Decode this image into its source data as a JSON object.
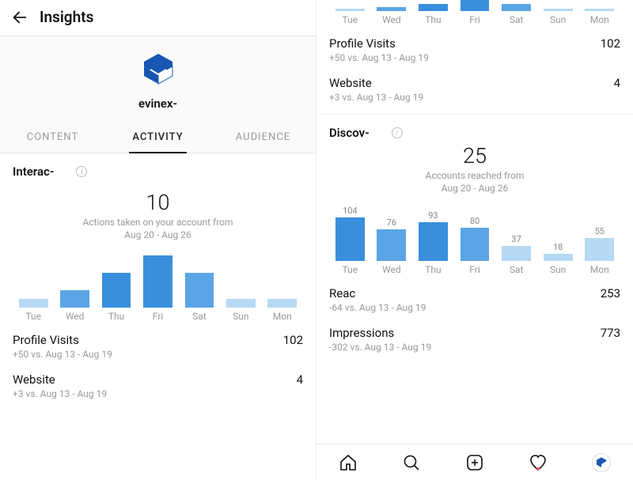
{
  "header": {
    "title": "Insights"
  },
  "profile": {
    "username": "evinex-"
  },
  "tabs": {
    "content": "CONTENT",
    "activity": "ACTIVITY",
    "audience": "AUDIENCE"
  },
  "left": {
    "section_title": "Interac-",
    "big_num": "10",
    "big_sub_l1": "Actions taken on your account from",
    "big_sub_l2": "Aug 20 - Aug 26",
    "metrics": {
      "pv_name": "Profile Visits",
      "pv_val": "102",
      "pv_sub": "+50 vs. Aug 13 - Aug 19",
      "web_name": "Website",
      "web_val": "4",
      "web_sub": "+3 vs. Aug 13 - Aug 19"
    }
  },
  "right": {
    "metrics_top": {
      "pv_name": "Profile Visits",
      "pv_val": "102",
      "pv_sub": "+50 vs. Aug 13 - Aug 19",
      "web_name": "Website",
      "web_val": "4",
      "web_sub": "+3 vs. Aug 13 - Aug 19"
    },
    "section_title": "Discov-",
    "big_num": "25",
    "big_sub_l1": "Accounts reached from",
    "big_sub_l2": "Aug 20 - Aug 26",
    "metrics_bot": {
      "reach_name": "Reac",
      "reach_val": "253",
      "reach_sub": "-64 vs. Aug 13 - Aug 19",
      "imp_name": "Impressions",
      "imp_val": "773",
      "imp_sub": "-302 vs. Aug 13 - Aug 19"
    }
  },
  "days": [
    "Tue",
    "Wed",
    "Thu",
    "Fri",
    "Sat",
    "Sun",
    "Mon"
  ],
  "chart_data": [
    {
      "type": "bar",
      "location": "left-panel interactions",
      "title": "Actions taken on your account from Aug 20 - Aug 26",
      "categories": [
        "Tue",
        "Wed",
        "Thu",
        "Fri",
        "Sat",
        "Sun",
        "Mon"
      ],
      "values": [
        0.5,
        1,
        2,
        3,
        2,
        0.5,
        0.5
      ],
      "colors": [
        "light",
        "medium",
        "dark",
        "dark",
        "medium",
        "light",
        "light"
      ],
      "total": 10,
      "note": "per-day values estimated from relative bar heights; only total (10) is labeled"
    },
    {
      "type": "bar",
      "location": "right-panel top (cropped duplicate of left chart)",
      "categories": [
        "Tue",
        "Wed",
        "Thu",
        "Fri",
        "Sat",
        "Sun",
        "Mon"
      ],
      "values": [
        0.5,
        1,
        2,
        3,
        2,
        0.5,
        0.5
      ],
      "colors": [
        "light",
        "medium",
        "dark",
        "dark",
        "medium",
        "light",
        "light"
      ]
    },
    {
      "type": "bar",
      "location": "right-panel discovery",
      "title": "Accounts reached from Aug 20 - Aug 26",
      "categories": [
        "Tue",
        "Wed",
        "Thu",
        "Fri",
        "Sat",
        "Sun",
        "Mon"
      ],
      "series": [
        {
          "name": "Accounts reached",
          "values": [
            104,
            76,
            93,
            80,
            37,
            18,
            55
          ]
        }
      ],
      "colors": [
        "dark",
        "medium",
        "dark",
        "medium",
        "light",
        "light",
        "light"
      ],
      "total": 25,
      "ylim": [
        0,
        110
      ]
    }
  ],
  "colors": {
    "dark": "#3a8fdd",
    "medium": "#5aa5e6",
    "light": "#b6d9f4"
  }
}
